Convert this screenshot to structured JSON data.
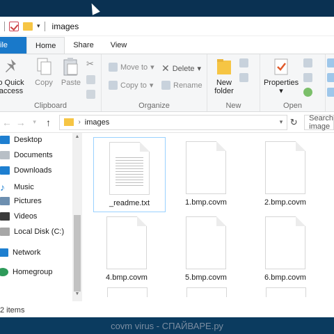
{
  "window": {
    "title": "images"
  },
  "tabs": [
    "ile",
    "Home",
    "Share",
    "View"
  ],
  "ribbon": {
    "clipboard": {
      "label": "Clipboard",
      "pin_label_1": "o Quick",
      "pin_label_2": "access",
      "copy_label": "Copy",
      "paste_label": "Paste"
    },
    "organize": {
      "label": "Organize",
      "move_to": "Move to",
      "copy_to": "Copy to",
      "delete": "Delete",
      "rename": "Rename"
    },
    "new": {
      "label": "New",
      "new_folder_1": "New",
      "new_folder_2": "folder"
    },
    "open": {
      "label": "Open",
      "properties": "Properties"
    }
  },
  "address": {
    "path": "images",
    "search_placeholder": "Search image"
  },
  "sidebar": {
    "items": [
      {
        "label": "Desktop",
        "icon": "desktop-icon",
        "color": "#1e7fd0"
      },
      {
        "label": "Documents",
        "icon": "documents-icon",
        "color": "#9a9a9a"
      },
      {
        "label": "Downloads",
        "icon": "downloads-icon",
        "color": "#1e7fd0"
      },
      {
        "label": "Music",
        "icon": "music-icon",
        "color": "#1e7fd0"
      },
      {
        "label": "Pictures",
        "icon": "pictures-icon",
        "color": "#6d8fb0"
      },
      {
        "label": "Videos",
        "icon": "videos-icon",
        "color": "#3a3a3a"
      },
      {
        "label": "Local Disk (C:)",
        "icon": "disk-icon",
        "color": "#8a8a8a"
      },
      {
        "label": "Network",
        "icon": "network-icon",
        "color": "#1e7fd0"
      },
      {
        "label": "Homegroup",
        "icon": "homegroup-icon",
        "color": "#2e9a5a"
      }
    ]
  },
  "files": [
    {
      "name": "_readme.txt",
      "type": "text",
      "selected": true
    },
    {
      "name": "1.bmp.covm",
      "type": "blank"
    },
    {
      "name": "2.bmp.covm",
      "type": "blank"
    },
    {
      "name": "4.bmp.covm",
      "type": "blank"
    },
    {
      "name": "5.bmp.covm",
      "type": "blank"
    },
    {
      "name": "6.bmp.covm",
      "type": "blank"
    }
  ],
  "status": {
    "items_count": "2 items"
  },
  "watermark": "covm virus - СПАЙВАРЕ.ру",
  "colors": {
    "accent": "#1979ca",
    "folder": "#f6c544",
    "desktop_bg": "#0b3b5f"
  }
}
